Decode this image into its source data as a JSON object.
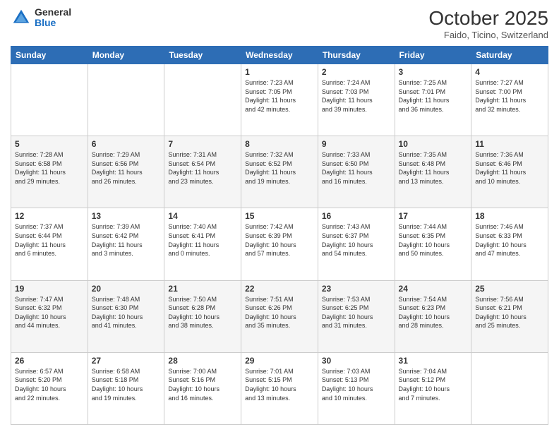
{
  "header": {
    "logo_general": "General",
    "logo_blue": "Blue",
    "month_title": "October 2025",
    "location": "Faido, Ticino, Switzerland"
  },
  "weekdays": [
    "Sunday",
    "Monday",
    "Tuesday",
    "Wednesday",
    "Thursday",
    "Friday",
    "Saturday"
  ],
  "weeks": [
    [
      {
        "day": "",
        "info": ""
      },
      {
        "day": "",
        "info": ""
      },
      {
        "day": "",
        "info": ""
      },
      {
        "day": "1",
        "info": "Sunrise: 7:23 AM\nSunset: 7:05 PM\nDaylight: 11 hours\nand 42 minutes."
      },
      {
        "day": "2",
        "info": "Sunrise: 7:24 AM\nSunset: 7:03 PM\nDaylight: 11 hours\nand 39 minutes."
      },
      {
        "day": "3",
        "info": "Sunrise: 7:25 AM\nSunset: 7:01 PM\nDaylight: 11 hours\nand 36 minutes."
      },
      {
        "day": "4",
        "info": "Sunrise: 7:27 AM\nSunset: 7:00 PM\nDaylight: 11 hours\nand 32 minutes."
      }
    ],
    [
      {
        "day": "5",
        "info": "Sunrise: 7:28 AM\nSunset: 6:58 PM\nDaylight: 11 hours\nand 29 minutes."
      },
      {
        "day": "6",
        "info": "Sunrise: 7:29 AM\nSunset: 6:56 PM\nDaylight: 11 hours\nand 26 minutes."
      },
      {
        "day": "7",
        "info": "Sunrise: 7:31 AM\nSunset: 6:54 PM\nDaylight: 11 hours\nand 23 minutes."
      },
      {
        "day": "8",
        "info": "Sunrise: 7:32 AM\nSunset: 6:52 PM\nDaylight: 11 hours\nand 19 minutes."
      },
      {
        "day": "9",
        "info": "Sunrise: 7:33 AM\nSunset: 6:50 PM\nDaylight: 11 hours\nand 16 minutes."
      },
      {
        "day": "10",
        "info": "Sunrise: 7:35 AM\nSunset: 6:48 PM\nDaylight: 11 hours\nand 13 minutes."
      },
      {
        "day": "11",
        "info": "Sunrise: 7:36 AM\nSunset: 6:46 PM\nDaylight: 11 hours\nand 10 minutes."
      }
    ],
    [
      {
        "day": "12",
        "info": "Sunrise: 7:37 AM\nSunset: 6:44 PM\nDaylight: 11 hours\nand 6 minutes."
      },
      {
        "day": "13",
        "info": "Sunrise: 7:39 AM\nSunset: 6:42 PM\nDaylight: 11 hours\nand 3 minutes."
      },
      {
        "day": "14",
        "info": "Sunrise: 7:40 AM\nSunset: 6:41 PM\nDaylight: 11 hours\nand 0 minutes."
      },
      {
        "day": "15",
        "info": "Sunrise: 7:42 AM\nSunset: 6:39 PM\nDaylight: 10 hours\nand 57 minutes."
      },
      {
        "day": "16",
        "info": "Sunrise: 7:43 AM\nSunset: 6:37 PM\nDaylight: 10 hours\nand 54 minutes."
      },
      {
        "day": "17",
        "info": "Sunrise: 7:44 AM\nSunset: 6:35 PM\nDaylight: 10 hours\nand 50 minutes."
      },
      {
        "day": "18",
        "info": "Sunrise: 7:46 AM\nSunset: 6:33 PM\nDaylight: 10 hours\nand 47 minutes."
      }
    ],
    [
      {
        "day": "19",
        "info": "Sunrise: 7:47 AM\nSunset: 6:32 PM\nDaylight: 10 hours\nand 44 minutes."
      },
      {
        "day": "20",
        "info": "Sunrise: 7:48 AM\nSunset: 6:30 PM\nDaylight: 10 hours\nand 41 minutes."
      },
      {
        "day": "21",
        "info": "Sunrise: 7:50 AM\nSunset: 6:28 PM\nDaylight: 10 hours\nand 38 minutes."
      },
      {
        "day": "22",
        "info": "Sunrise: 7:51 AM\nSunset: 6:26 PM\nDaylight: 10 hours\nand 35 minutes."
      },
      {
        "day": "23",
        "info": "Sunrise: 7:53 AM\nSunset: 6:25 PM\nDaylight: 10 hours\nand 31 minutes."
      },
      {
        "day": "24",
        "info": "Sunrise: 7:54 AM\nSunset: 6:23 PM\nDaylight: 10 hours\nand 28 minutes."
      },
      {
        "day": "25",
        "info": "Sunrise: 7:56 AM\nSunset: 6:21 PM\nDaylight: 10 hours\nand 25 minutes."
      }
    ],
    [
      {
        "day": "26",
        "info": "Sunrise: 6:57 AM\nSunset: 5:20 PM\nDaylight: 10 hours\nand 22 minutes."
      },
      {
        "day": "27",
        "info": "Sunrise: 6:58 AM\nSunset: 5:18 PM\nDaylight: 10 hours\nand 19 minutes."
      },
      {
        "day": "28",
        "info": "Sunrise: 7:00 AM\nSunset: 5:16 PM\nDaylight: 10 hours\nand 16 minutes."
      },
      {
        "day": "29",
        "info": "Sunrise: 7:01 AM\nSunset: 5:15 PM\nDaylight: 10 hours\nand 13 minutes."
      },
      {
        "day": "30",
        "info": "Sunrise: 7:03 AM\nSunset: 5:13 PM\nDaylight: 10 hours\nand 10 minutes."
      },
      {
        "day": "31",
        "info": "Sunrise: 7:04 AM\nSunset: 5:12 PM\nDaylight: 10 hours\nand 7 minutes."
      },
      {
        "day": "",
        "info": ""
      }
    ]
  ]
}
